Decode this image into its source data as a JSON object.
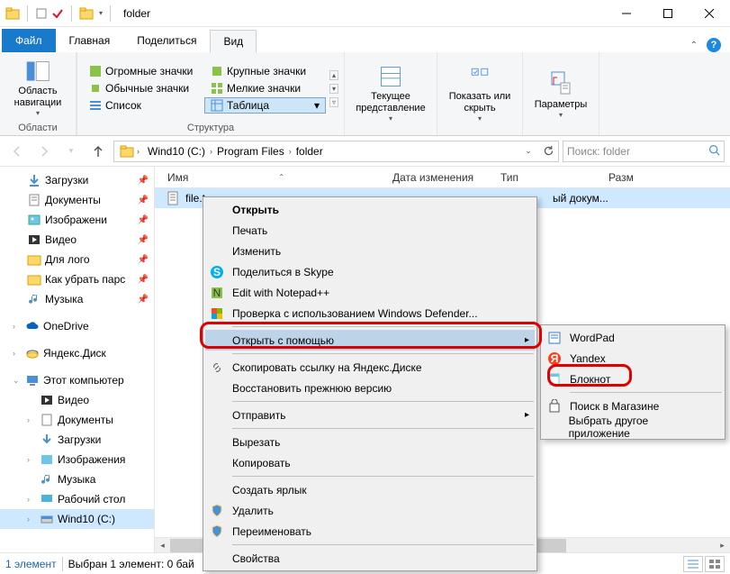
{
  "window": {
    "title": "folder"
  },
  "tabs": {
    "file": "Файл",
    "home": "Главная",
    "share": "Поделиться",
    "view": "Вид"
  },
  "ribbon": {
    "nav": {
      "label": "Область навигации",
      "group": "Области"
    },
    "layout": {
      "huge": "Огромные значки",
      "large": "Крупные значки",
      "normal": "Обычные значки",
      "small": "Мелкие значки",
      "list": "Список",
      "table": "Таблица",
      "group": "Структура"
    },
    "current": {
      "label": "Текущее представление"
    },
    "show": {
      "label": "Показать или скрыть"
    },
    "params": {
      "label": "Параметры"
    }
  },
  "breadcrumb": {
    "drive": "Wind10 (C:)",
    "pf": "Program Files",
    "folder": "folder"
  },
  "search": {
    "placeholder": "Поиск: folder"
  },
  "columns": {
    "name": "Имя",
    "date": "Дата изменения",
    "type": "Тип",
    "size": "Разм"
  },
  "file": {
    "name": "file.t",
    "type_trunc": "ый докум..."
  },
  "tree": {
    "downloads": "Загрузки",
    "documents": "Документы",
    "images": "Изображени",
    "video": "Видео",
    "for_logo": "Для лого",
    "howto": "Как убрать парс",
    "music": "Музыка",
    "onedrive": "OneDrive",
    "yadisk": "Яндекс.Диск",
    "thispc": "Этот компьютер",
    "video2": "Видео",
    "documents2": "Документы",
    "downloads2": "Загрузки",
    "images2": "Изображения",
    "music2": "Музыка",
    "desktop": "Рабочий стол",
    "drive": "Wind10 (C:)"
  },
  "context": {
    "open": "Открыть",
    "print": "Печать",
    "edit": "Изменить",
    "skype": "Поделиться в Skype",
    "npp": "Edit with Notepad++",
    "defender": "Проверка с использованием Windows Defender...",
    "openwith": "Открыть с помощью",
    "yalink": "Скопировать ссылку на Яндекс.Диске",
    "restore": "Восстановить прежнюю версию",
    "sendto": "Отправить",
    "cut": "Вырезать",
    "copy": "Копировать",
    "shortcut": "Создать ярлык",
    "delete": "Удалить",
    "rename": "Переименовать",
    "properties": "Свойства"
  },
  "submenu": {
    "wordpad": "WordPad",
    "yandex": "Yandex",
    "notepad": "Блокнот",
    "store": "Поиск в Магазине",
    "other": "Выбрать другое приложение"
  },
  "status": {
    "count": "1 элемент",
    "selection": "Выбран 1 элемент: 0 бай"
  }
}
